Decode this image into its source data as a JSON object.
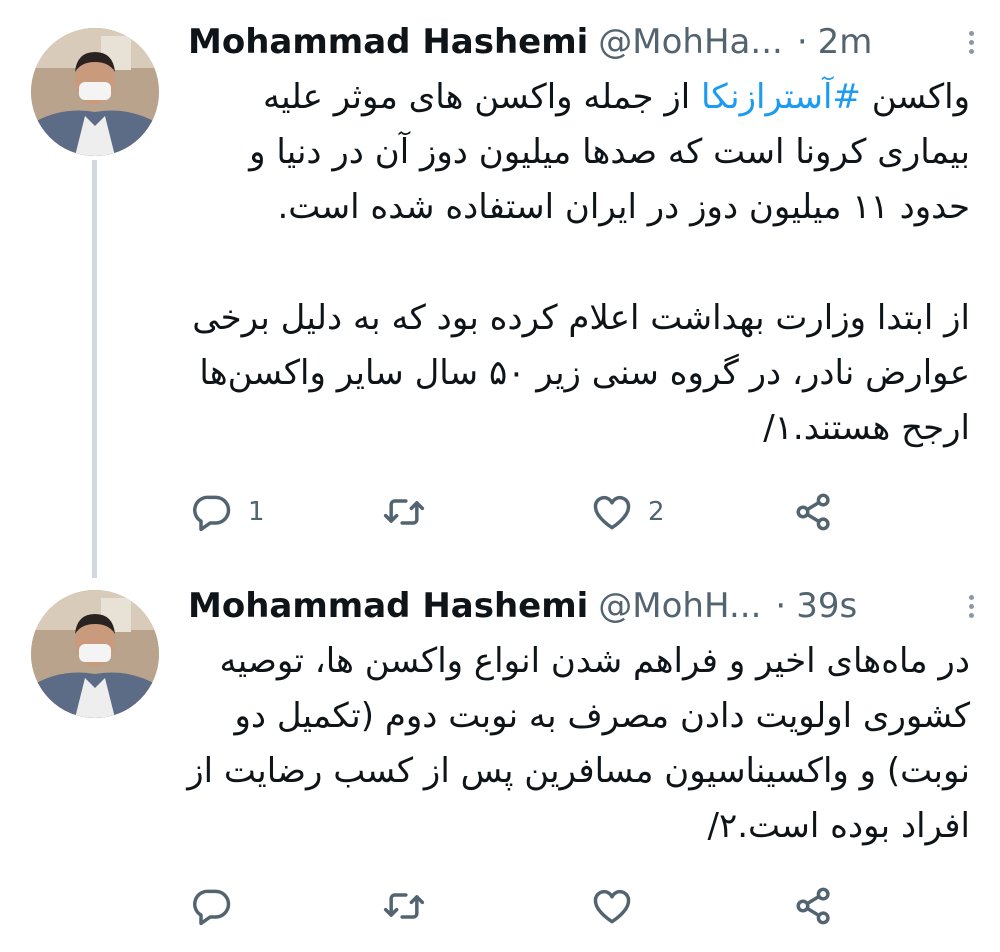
{
  "thread": [
    {
      "author": {
        "name": "Mohammad Hashemi",
        "handle": "@MohHa...",
        "avatar": "avatar-photo"
      },
      "separator": "·",
      "time": "2m",
      "paragraphs": [
        {
          "hashtag": "#آسترازنکا",
          "before": "واکسن ",
          "after": " از جمله واکسن های موثر علیه بیماری کرونا است که صدها میلیون دوز آن در دنیا و حدود ۱۱ میلیون دوز در ایران استفاده شده است."
        },
        {
          "text": "از ابتدا وزارت بهداشت اعلام کرده بود که به دلیل برخی عوارض نادر، در گروه سنی زیر ۵۰ سال سایر واکسن‌ها ارجح هستند.۱/"
        }
      ],
      "actions": {
        "replies": "1",
        "retweets": "",
        "likes": "2"
      }
    },
    {
      "author": {
        "name": "Mohammad Hashemi",
        "handle": "@MohH...",
        "avatar": "avatar-photo"
      },
      "separator": "·",
      "time": "39s",
      "paragraphs": [
        {
          "text": "در ماه‌های اخیر و فراهم شدن انواع واکسن ها، توصیه کشوری اولویت دادن مصرف به نوبت دوم (تکمیل دو نوبت) و واکسیناسیون مسافرین پس از کسب رضایت از افراد بوده است.۲/"
        }
      ],
      "actions": {
        "replies": "",
        "retweets": "",
        "likes": ""
      }
    }
  ],
  "colors": {
    "text": "#0f1419",
    "secondary": "#536471",
    "link": "#1d9bf0",
    "thread_line": "#cfd9de",
    "background": "#ffffff"
  },
  "icons": [
    "reply-icon",
    "retweet-icon",
    "like-icon",
    "share-icon",
    "more-options-icon"
  ]
}
